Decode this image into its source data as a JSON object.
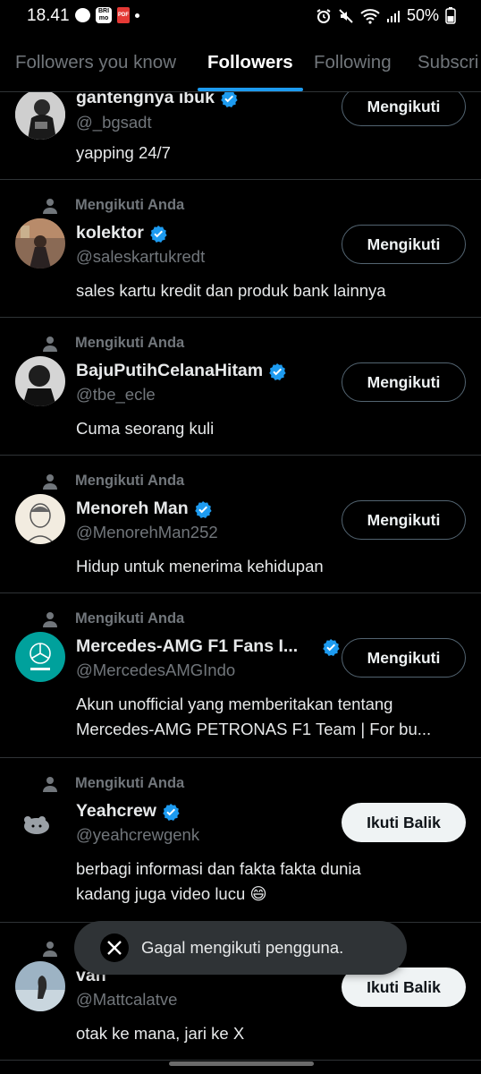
{
  "status_bar": {
    "time": "18.41",
    "bri_label": "BRI mo",
    "pdf_label": "PDF",
    "battery": "50%"
  },
  "tabs": [
    {
      "label": "Followers you know"
    },
    {
      "label": "Followers"
    },
    {
      "label": "Following"
    },
    {
      "label": "Subscri"
    }
  ],
  "context_label": "Mengikuti Anda",
  "users": [
    {
      "name": "gantengnya ibuk",
      "verified": true,
      "handle": "@_bgsadt",
      "bio": "yapping 24/7",
      "button": "Mengikuti",
      "button_state": "following"
    },
    {
      "name": "kolektor",
      "verified": true,
      "handle": "@saleskartukredt",
      "bio": "sales kartu kredit dan produk bank lainnya",
      "button": "Mengikuti",
      "button_state": "following"
    },
    {
      "name": "BajuPutihCelanaHitam",
      "verified": true,
      "handle": "@tbe_ecle",
      "bio": "Cuma seorang kuli",
      "button": "Mengikuti",
      "button_state": "following"
    },
    {
      "name": "Menoreh Man",
      "verified": true,
      "handle": "@MenorehMan252",
      "bio": "Hidup untuk menerima kehidupan",
      "button": "Mengikuti",
      "button_state": "following"
    },
    {
      "name": "Mercedes-AMG F1 Fans I...",
      "verified": true,
      "handle": "@MercedesAMGIndo",
      "bio_line1": "Akun unofficial yang memberitakan tentang",
      "bio_line2": "Mercedes-AMG PETRONAS F1 Team | For bu...",
      "button": "Mengikuti",
      "button_state": "following"
    },
    {
      "name": "Yeahcrew",
      "verified": true,
      "handle": "@yeahcrewgenk",
      "bio_line1": "berbagi informasi dan fakta fakta dunia",
      "bio_line2": "kadang juga video lucu 😄",
      "button": "Ikuti Balik",
      "button_state": "follow-back"
    },
    {
      "name": "van",
      "verified": false,
      "handle": "@Mattcalatve",
      "bio": "otak ke mana, jari ke X",
      "button": "Ikuti Balik",
      "button_state": "follow-back"
    }
  ],
  "toast": {
    "text": "Gagal mengikuti pengguna."
  },
  "colors": {
    "accent": "#1d9bf0",
    "background": "#000000",
    "secondary_text": "#71767b",
    "divider": "#2f3336"
  }
}
